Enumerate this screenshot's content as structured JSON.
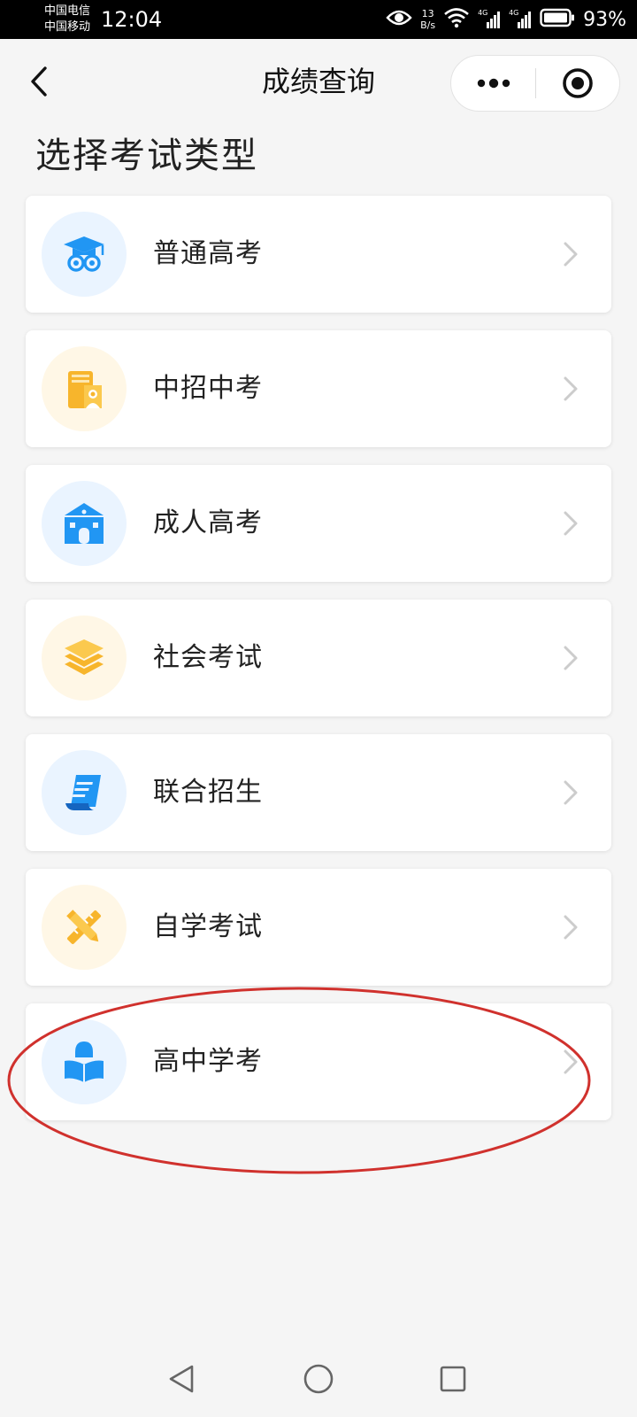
{
  "status_bar": {
    "carrier_1": "中国电信",
    "carrier_2": "中国移动",
    "time": "12:04",
    "net_speed_value": "13",
    "net_speed_unit": "B/s",
    "signal_label_1": "4G",
    "signal_label_2": "4G",
    "battery": "93%"
  },
  "nav": {
    "title": "成绩查询"
  },
  "page": {
    "heading": "选择考试类型"
  },
  "exam_types": [
    {
      "label": "普通高考",
      "icon": "graduation-cap-icon",
      "tint": "blue"
    },
    {
      "label": "中招中考",
      "icon": "book-student-icon",
      "tint": "yellow"
    },
    {
      "label": "成人高考",
      "icon": "school-building-icon",
      "tint": "blue"
    },
    {
      "label": "社会考试",
      "icon": "layers-icon",
      "tint": "yellow"
    },
    {
      "label": "联合招生",
      "icon": "document-scroll-icon",
      "tint": "blue"
    },
    {
      "label": "自学考试",
      "icon": "crossed-pencil-ruler-icon",
      "tint": "yellow"
    },
    {
      "label": "高中学考",
      "icon": "reading-student-icon",
      "tint": "blue"
    }
  ],
  "colors": {
    "accent_blue": "#2196f3",
    "accent_yellow": "#f7b52c",
    "annotation_red": "#d0312d",
    "background": "#f5f5f5"
  }
}
